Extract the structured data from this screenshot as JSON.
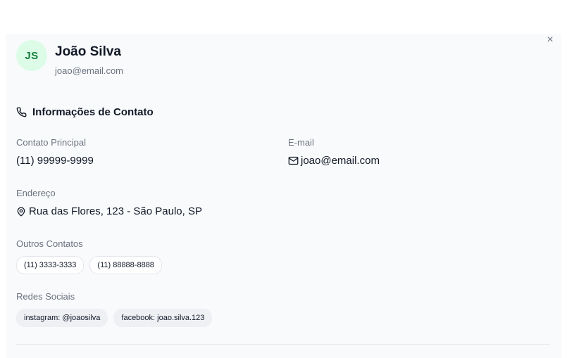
{
  "header": {
    "avatar_initials": "JS",
    "name": "João Silva",
    "email": "joao@email.com",
    "close_glyph": "×"
  },
  "contact_section": {
    "title": "Informações de Contato",
    "icon": "phone-icon"
  },
  "fields": {
    "main_contact_label": "Contato Principal",
    "main_contact_value": "(11) 99999-9999",
    "email_label": "E-mail",
    "email_value": "joao@email.com",
    "address_label": "Endereço",
    "address_value": "Rua das Flores, 123 - São Paulo, SP"
  },
  "other_contacts": {
    "label": "Outros Contatos",
    "items": [
      "(11) 3333-3333",
      "(11) 88888-8888"
    ]
  },
  "social": {
    "label": "Redes Sociais",
    "items": [
      "instagram: @joaosilva",
      "facebook: joao.silva.123"
    ]
  },
  "colors": {
    "avatar_bg": "#dcfce7",
    "avatar_text": "#15803d",
    "panel_bg": "#f9fafb",
    "muted_text": "#6b7280"
  }
}
